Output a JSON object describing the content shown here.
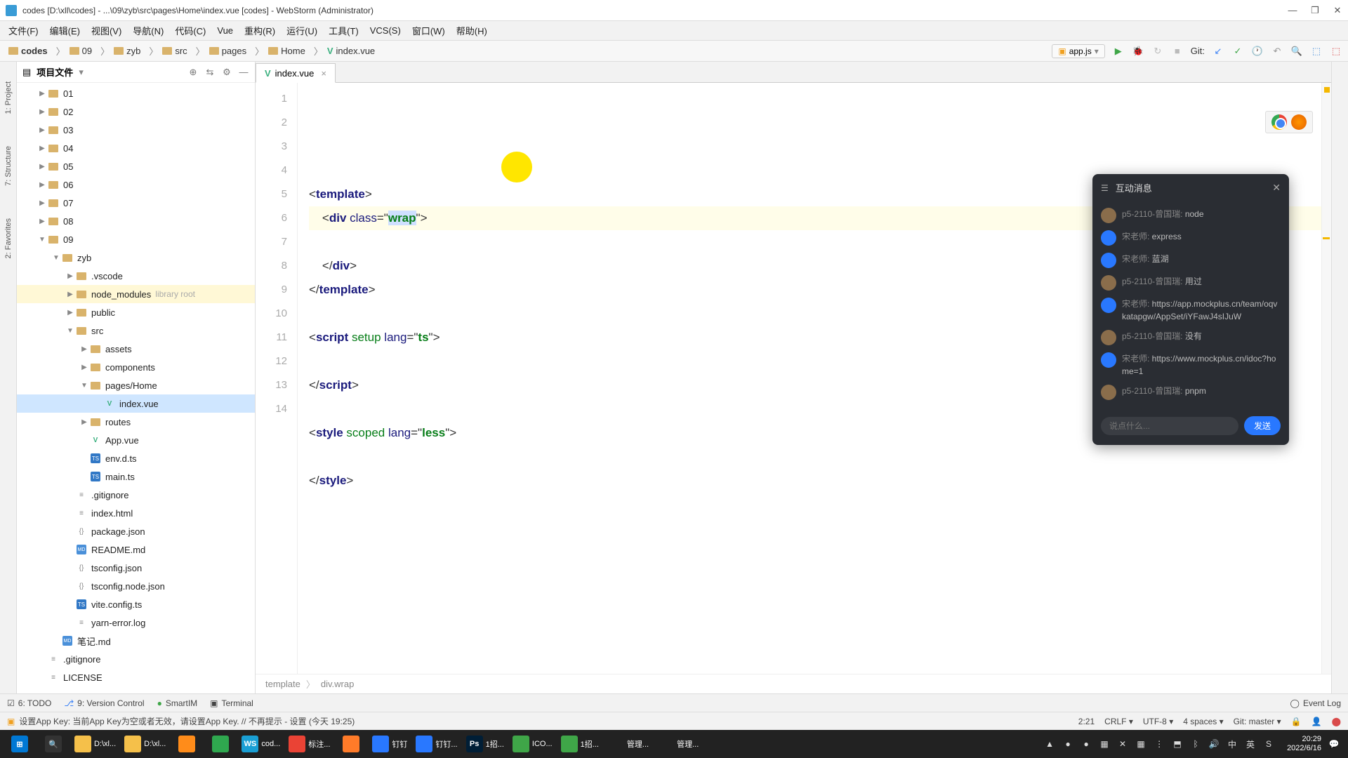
{
  "window": {
    "title": "codes [D:\\xll\\codes] - ...\\09\\zyb\\src\\pages\\Home\\index.vue [codes] - WebStorm (Administrator)"
  },
  "menu": [
    "文件(F)",
    "编辑(E)",
    "视图(V)",
    "导航(N)",
    "代码(C)",
    "Vue",
    "重构(R)",
    "运行(U)",
    "工具(T)",
    "VCS(S)",
    "窗口(W)",
    "帮助(H)"
  ],
  "breadcrumbs": [
    "codes",
    "09",
    "zyb",
    "src",
    "pages",
    "Home",
    "index.vue"
  ],
  "runConfig": "app.js",
  "git": {
    "label": "Git:"
  },
  "project": {
    "title": "项目文件",
    "tree": [
      {
        "depth": 1,
        "arrow": "▶",
        "type": "dir",
        "name": "01"
      },
      {
        "depth": 1,
        "arrow": "▶",
        "type": "dir",
        "name": "02"
      },
      {
        "depth": 1,
        "arrow": "▶",
        "type": "dir",
        "name": "03"
      },
      {
        "depth": 1,
        "arrow": "▶",
        "type": "dir",
        "name": "04"
      },
      {
        "depth": 1,
        "arrow": "▶",
        "type": "dir",
        "name": "05"
      },
      {
        "depth": 1,
        "arrow": "▶",
        "type": "dir",
        "name": "06"
      },
      {
        "depth": 1,
        "arrow": "▶",
        "type": "dir",
        "name": "07"
      },
      {
        "depth": 1,
        "arrow": "▶",
        "type": "dir",
        "name": "08"
      },
      {
        "depth": 1,
        "arrow": "▼",
        "type": "dir",
        "name": "09"
      },
      {
        "depth": 2,
        "arrow": "▼",
        "type": "dir",
        "name": "zyb"
      },
      {
        "depth": 3,
        "arrow": "▶",
        "type": "dir",
        "name": ".vscode"
      },
      {
        "depth": 3,
        "arrow": "▶",
        "type": "dir",
        "name": "node_modules",
        "hint": "library root",
        "highlight": true
      },
      {
        "depth": 3,
        "arrow": "▶",
        "type": "dir",
        "name": "public"
      },
      {
        "depth": 3,
        "arrow": "▼",
        "type": "dir",
        "name": "src"
      },
      {
        "depth": 4,
        "arrow": "▶",
        "type": "dir",
        "name": "assets"
      },
      {
        "depth": 4,
        "arrow": "▶",
        "type": "dir",
        "name": "components"
      },
      {
        "depth": 4,
        "arrow": "▼",
        "type": "dir",
        "name": "pages/Home"
      },
      {
        "depth": 5,
        "arrow": "",
        "type": "vue",
        "name": "index.vue",
        "selected": true
      },
      {
        "depth": 4,
        "arrow": "▶",
        "type": "dir",
        "name": "routes"
      },
      {
        "depth": 4,
        "arrow": "",
        "type": "vue",
        "name": "App.vue"
      },
      {
        "depth": 4,
        "arrow": "",
        "type": "ts",
        "name": "env.d.ts"
      },
      {
        "depth": 4,
        "arrow": "",
        "type": "ts",
        "name": "main.ts"
      },
      {
        "depth": 3,
        "arrow": "",
        "type": "txt",
        "name": ".gitignore"
      },
      {
        "depth": 3,
        "arrow": "",
        "type": "txt",
        "name": "index.html"
      },
      {
        "depth": 3,
        "arrow": "",
        "type": "json",
        "name": "package.json"
      },
      {
        "depth": 3,
        "arrow": "",
        "type": "md",
        "name": "README.md"
      },
      {
        "depth": 3,
        "arrow": "",
        "type": "json",
        "name": "tsconfig.json"
      },
      {
        "depth": 3,
        "arrow": "",
        "type": "json",
        "name": "tsconfig.node.json"
      },
      {
        "depth": 3,
        "arrow": "",
        "type": "ts",
        "name": "vite.config.ts"
      },
      {
        "depth": 3,
        "arrow": "",
        "type": "txt",
        "name": "yarn-error.log"
      },
      {
        "depth": 2,
        "arrow": "",
        "type": "md",
        "name": "笔记.md"
      },
      {
        "depth": 1,
        "arrow": "",
        "type": "txt",
        "name": ".gitignore"
      },
      {
        "depth": 1,
        "arrow": "",
        "type": "txt",
        "name": "LICENSE"
      }
    ]
  },
  "sideTools": {
    "project": "1: Project",
    "favorites": "2: Favorites",
    "structure": "7: Structure"
  },
  "tab": {
    "name": "index.vue"
  },
  "code": {
    "lines": [
      {
        "n": 1,
        "html": "<span class='punct'>&lt;</span><span class='tag'>template</span><span class='punct'>&gt;</span>"
      },
      {
        "n": 2,
        "html": "    <span class='punct'>&lt;</span><span class='tag'>div</span> <span class='attr'>class</span><span class='punct'>=&quot;</span><span class='val sel-bg'>wrap</span><span class='punct'>&quot;&gt;</span>",
        "hl": true
      },
      {
        "n": 3,
        "html": ""
      },
      {
        "n": 4,
        "html": "    <span class='punct'>&lt;/</span><span class='tag'>div</span><span class='punct'>&gt;</span>"
      },
      {
        "n": 5,
        "html": "<span class='punct'>&lt;/</span><span class='tag'>template</span><span class='punct'>&gt;</span>"
      },
      {
        "n": 6,
        "html": ""
      },
      {
        "n": 7,
        "html": "<span class='punct'>&lt;</span><span class='tag'>script</span> <span class='kw'>setup</span> <span class='attr'>lang</span><span class='punct'>=&quot;</span><span class='val'>ts</span><span class='punct'>&quot;&gt;</span>"
      },
      {
        "n": 8,
        "html": ""
      },
      {
        "n": 9,
        "html": "<span class='punct'>&lt;/</span><span class='tag'>script</span><span class='punct'>&gt;</span>"
      },
      {
        "n": 10,
        "html": ""
      },
      {
        "n": 11,
        "html": "<span class='punct'>&lt;</span><span class='tag'>style</span> <span class='kw'>scoped</span> <span class='attr'>lang</span><span class='punct'>=&quot;</span><span class='val'>less</span><span class='punct'>&quot;&gt;</span>"
      },
      {
        "n": 12,
        "html": ""
      },
      {
        "n": 13,
        "html": "<span class='punct'>&lt;/</span><span class='tag'>style</span><span class='punct'>&gt;</span>"
      },
      {
        "n": 14,
        "html": ""
      }
    ]
  },
  "crumbPath": [
    "template",
    "div.wrap"
  ],
  "chat": {
    "title": "互动消息",
    "placeholder": "说点什么...",
    "send": "发送",
    "msgs": [
      {
        "av": "a",
        "name": "p5-2110-曾国瑞:",
        "text": "node"
      },
      {
        "av": "b",
        "name": "宋老师:",
        "text": "express"
      },
      {
        "av": "b",
        "name": "宋老师:",
        "text": "蓝湖"
      },
      {
        "av": "a",
        "name": "p5-2110-曾国瑞:",
        "text": "用过"
      },
      {
        "av": "b",
        "name": "宋老师:",
        "text": "https://app.mockplus.cn/team/oqvkatapgw/AppSet/iYFawJ4sIJuW"
      },
      {
        "av": "a",
        "name": "p5-2110-曾国瑞:",
        "text": "没有"
      },
      {
        "av": "b",
        "name": "宋老师:",
        "text": "https://www.mockplus.cn/idoc?home=1"
      },
      {
        "av": "a",
        "name": "p5-2110-曾国瑞:",
        "text": "pnpm"
      }
    ]
  },
  "bottom": {
    "todo": "6: TODO",
    "vcs": "9: Version Control",
    "smartim": "SmartIM",
    "terminal": "Terminal",
    "eventlog": "Event Log"
  },
  "status": {
    "msg": "设置App Key: 当前App Key为空或者无效，请设置App Key. // 不再提示 - 设置 (今天 19:25)",
    "pos": "2:21",
    "eol": "CRLF",
    "enc": "UTF-8",
    "indent": "4 spaces",
    "git": "Git: master"
  },
  "taskbar": {
    "items": [
      {
        "color": "#0078d4",
        "label": "",
        "icon": "⊞"
      },
      {
        "color": "#333",
        "label": "",
        "icon": "🔍"
      },
      {
        "color": "#f5c04a",
        "label": "D:\\xl..."
      },
      {
        "color": "#f5c04a",
        "label": "D:\\xl..."
      },
      {
        "color": "#ff8c1a",
        "label": ""
      },
      {
        "color": "#2fa84f",
        "label": ""
      },
      {
        "color": "#1a9fd4",
        "label": "cod...",
        "icon": "WS"
      },
      {
        "color": "#ea4335",
        "label": "标注..."
      },
      {
        "color": "#ff7b29",
        "label": ""
      },
      {
        "color": "#2978ff",
        "label": "钉钉"
      },
      {
        "color": "#2978ff",
        "label": "钉钉..."
      },
      {
        "color": "#001e36",
        "label": "1招...",
        "icon": "Ps"
      },
      {
        "color": "#3fa648",
        "label": "ICO..."
      },
      {
        "color": "#3fa648",
        "label": "1招..."
      },
      {
        "color": "#222",
        "label": "管理..."
      },
      {
        "color": "#222",
        "label": "管理..."
      }
    ],
    "tray": [
      "▲",
      "●",
      "●",
      "▦",
      "✕",
      "▦",
      "⋮",
      "⬒",
      "ᛒ",
      "🔊",
      "中",
      "英",
      "S"
    ],
    "time": "20:29",
    "date": "2022/6/16"
  }
}
